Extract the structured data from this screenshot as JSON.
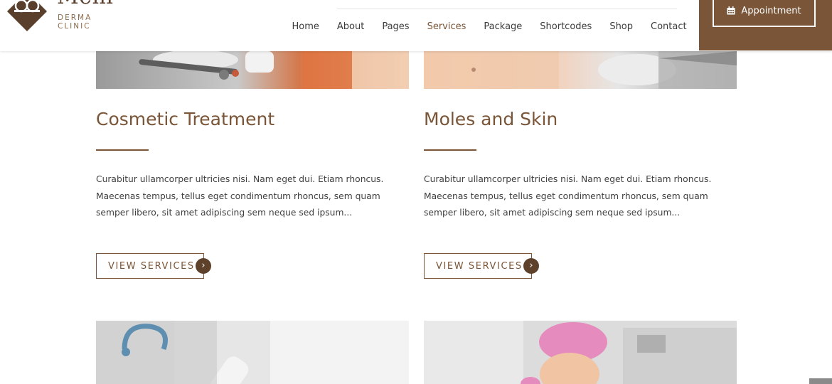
{
  "logo": {
    "name": "Meni",
    "tagline": "DERMA CLINIC"
  },
  "nav": [
    "Home",
    "About",
    "Pages",
    "Services",
    "Package",
    "Shortcodes",
    "Shop",
    "Contact"
  ],
  "nav_active": "Services",
  "appointment": {
    "label": "Appointment",
    "icon": "calendar-icon"
  },
  "cards": [
    {
      "title": "Cosmetic Treatment",
      "text": "Curabitur ullamcorper ultricies nisi. Nam eget dui. Etiam rhoncus. Maecenas tempus, tellus eget condimentum rhoncus, sem quam semper libero, sit amet adipiscing sem neque sed ipsum...",
      "button": "VIEW SERVICES"
    },
    {
      "title": "Moles and Skin",
      "text": "Curabitur ullamcorper ultricies nisi. Nam eget dui. Etiam rhoncus. Maecenas tempus, tellus eget condimentum rhoncus, sem quam semper libero, sit amet adipiscing sem neque sed ipsum...",
      "button": "VIEW SERVICES"
    }
  ],
  "colors": {
    "accent": "#7a5537",
    "button_circle": "#5e412b"
  }
}
